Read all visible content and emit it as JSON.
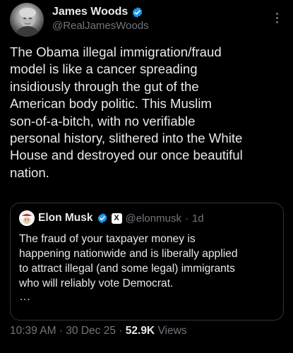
{
  "author": {
    "display_name": "James Woods",
    "handle": "@RealJamesWoods",
    "verified": true,
    "avatar_icon": "avatar-photo"
  },
  "post": {
    "text": "The Obama illegal immigration/fraud\nmodel is like a cancer spreading\ninsidiously through the gut of the\nAmerican body politic. This Muslim\nson-of-a-bitch, with no verifiable\npersonal history, slithered into the White\nHouse and destroyed our once beautiful\nnation."
  },
  "quote": {
    "display_name": "Elon Musk",
    "handle": "@elonmusk",
    "separator": "·",
    "time": "1d",
    "affiliate_badge": "X",
    "verified": true,
    "text": "The fraud of your taxpayer money is\nhappening nationwide and is liberally applied\nto attract illegal (and some legal) immigrants\nwho will reliably vote Democrat.",
    "ellipsis": "..."
  },
  "meta": {
    "time": "10:39 AM",
    "separator1": "·",
    "date": "30 Dec 25",
    "separator2": "·",
    "views_count": "52.9K",
    "views_label": "Views"
  },
  "colors": {
    "background": "#000000",
    "text": "#e7e9ea",
    "secondary": "#71767b",
    "verified_blue": "#1d9bf0",
    "border": "#2f3336"
  }
}
